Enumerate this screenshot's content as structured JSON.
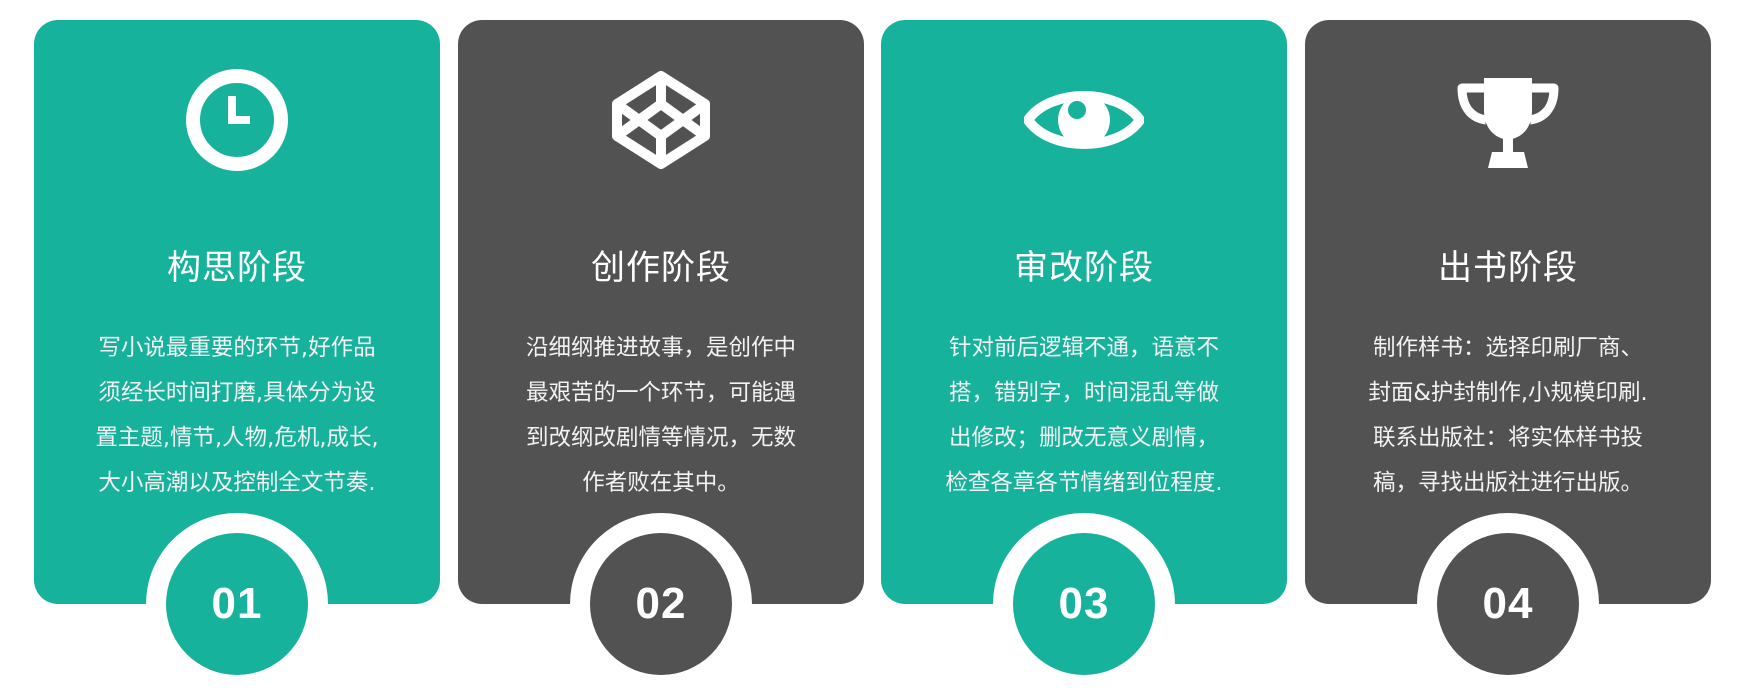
{
  "colors": {
    "teal": "#17b29c",
    "dark": "#525252",
    "text": "#ffffff"
  },
  "cards": [
    {
      "icon": "clock-icon",
      "title": "构思阶段",
      "lines": [
        "写小说最重要的环节,好作品",
        "须经长时间打磨,具体分为设",
        "置主题,情节,人物,危机,成长,",
        "大小高潮以及控制全文节奏."
      ],
      "number": "01"
    },
    {
      "icon": "codepen-cube-icon",
      "title": "创作阶段",
      "lines": [
        "沿细纲推进故事，是创作中",
        "最艰苦的一个环节，可能遇",
        "到改纲改剧情等情况，无数",
        "作者败在其中。"
      ],
      "number": "02"
    },
    {
      "icon": "eye-icon",
      "title": "审改阶段",
      "lines": [
        "针对前后逻辑不通，语意不",
        "搭，错别字，时间混乱等做",
        "出修改；删改无意义剧情，",
        "检查各章各节情绪到位程度."
      ],
      "number": "03"
    },
    {
      "icon": "trophy-icon",
      "title": "出书阶段",
      "lines": [
        "制作样书：选择印刷厂商、",
        "封面&护封制作,小规模印刷.",
        "联系出版社：将实体样书投",
        "稿，寻找出版社进行出版。"
      ],
      "number": "04"
    }
  ]
}
